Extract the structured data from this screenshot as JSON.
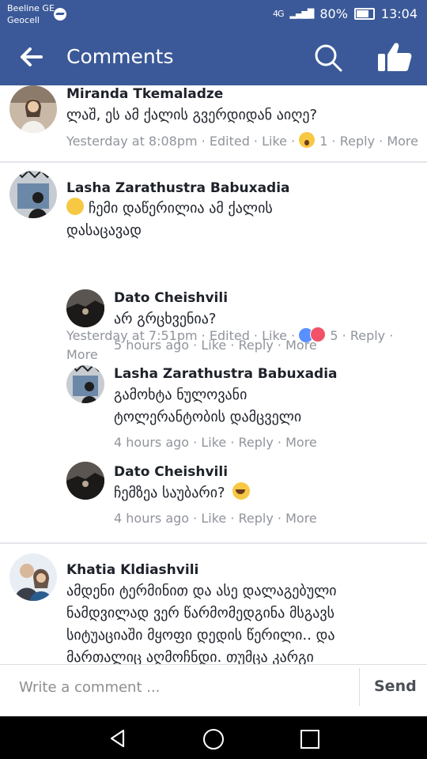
{
  "statusbar": {
    "carrier_line1": "Beeline GE",
    "carrier_line2": "Geocell",
    "network": "4G",
    "battery": "80%",
    "time": "13:04"
  },
  "appbar": {
    "title": "Comments",
    "icons": [
      "back-arrow-icon",
      "search-icon",
      "thumbs-up-icon"
    ]
  },
  "comments": [
    {
      "name": "Miranda Tkemaladze",
      "text": "ლაშ, ეს ამ ქალის გვერდიდან აიღე?",
      "time": "Yesterday at 8:08pm",
      "edited": "Edited",
      "like": "Like",
      "reaction_count": "1",
      "reply": "Reply",
      "more": "More"
    },
    {
      "name": "Lasha Zarathustra Babuxadia",
      "text_line1": "ჩემი დაწერილია ამ ქალის",
      "text_line2": "დასაცავად",
      "time": "Yesterday at 7:51pm",
      "edited": "Edited",
      "like": "Like",
      "reaction_count": "5",
      "reply": "Reply",
      "more": "More"
    }
  ],
  "replies": [
    {
      "name": "Dato Cheishvili",
      "text": "არ გრცხვენია?",
      "time": "5 hours ago",
      "like": "Like",
      "reply": "Reply",
      "more": "More"
    },
    {
      "name": "Lasha Zarathustra Babuxadia",
      "text_line1": "გამოხტა ნულოვანი",
      "text_line2": "ტოლერანტობის დამცველი",
      "time": "4 hours ago",
      "like": "Like",
      "reply": "Reply",
      "more": "More"
    },
    {
      "name": "Dato Cheishvili",
      "text": "ჩემზეა საუბარი?",
      "time": "4 hours ago",
      "like": "Like",
      "reply": "Reply",
      "more": "More"
    }
  ],
  "last_comment": {
    "name": "Khatia Kldiashvili",
    "line1": "ამდენი ტერმინით და ასე დალაგებული",
    "line2": "ნამდვილად ვერ წარმომედგინა მსგავს",
    "line3": "სიტუაციაში მყოფი დედის წერილი.. და",
    "line4": "მართალიც აღმოჩნდი. თუმცა კარგი"
  },
  "composer": {
    "placeholder": "Write a comment ...",
    "send_label": "Send"
  },
  "colors": {
    "brand": "#3b5998",
    "meta": "#90949c"
  }
}
